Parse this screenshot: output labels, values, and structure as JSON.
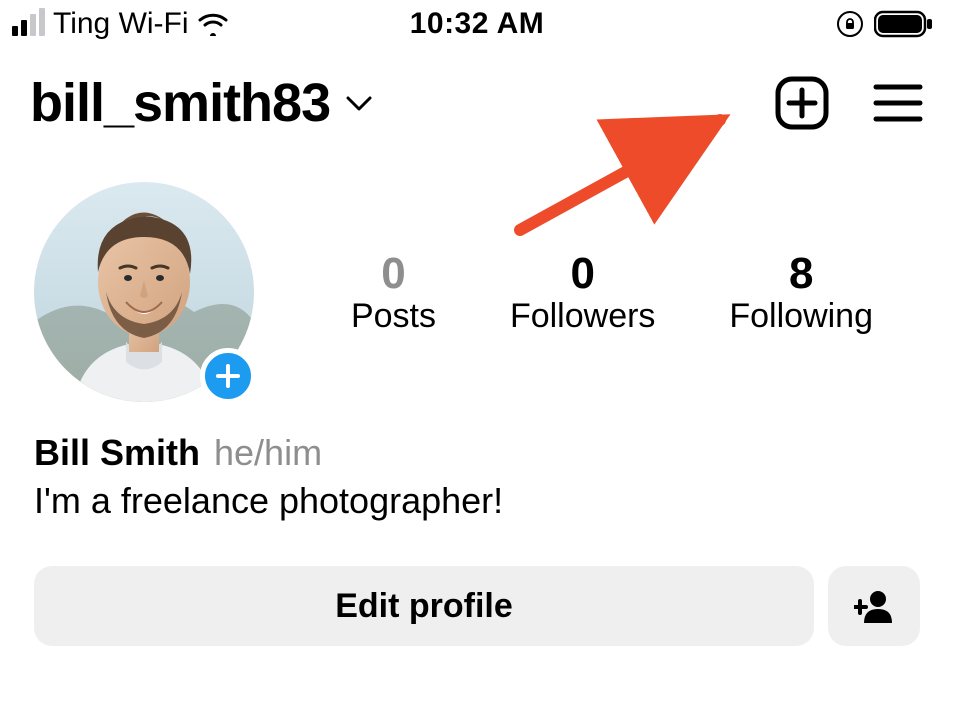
{
  "status_bar": {
    "carrier": "Ting Wi-Fi",
    "time": "10:32 AM"
  },
  "header": {
    "username": "bill_smith83"
  },
  "stats": {
    "posts": {
      "value": "0",
      "label": "Posts"
    },
    "followers": {
      "value": "0",
      "label": "Followers"
    },
    "following": {
      "value": "8",
      "label": "Following"
    }
  },
  "bio": {
    "display_name": "Bill Smith",
    "pronouns": "he/him",
    "text": "I'm a freelance photographer!"
  },
  "actions": {
    "edit_profile_label": "Edit profile"
  }
}
